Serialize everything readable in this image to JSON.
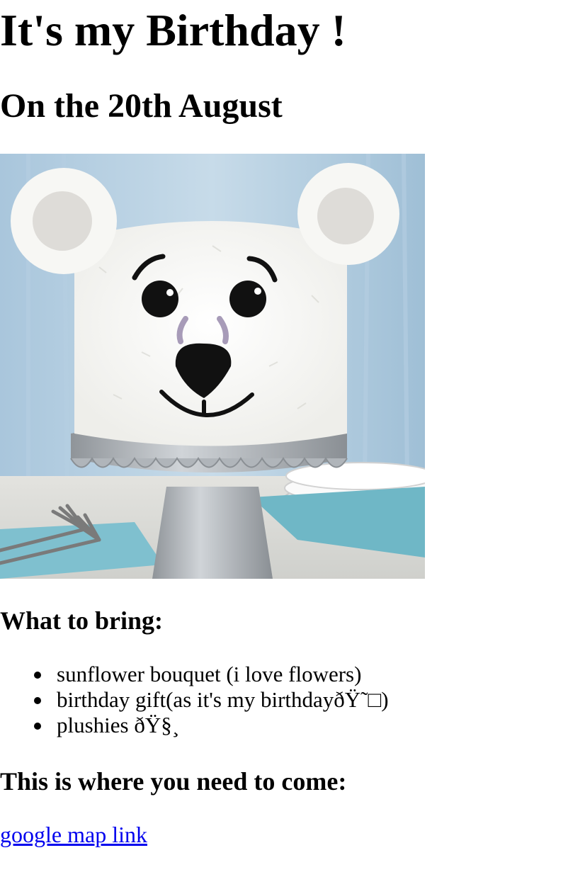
{
  "page": {
    "title": "It's my Birthday !",
    "subtitle": "On the 20th August"
  },
  "image": {
    "alt": "",
    "icon": "polar-bear-cake-photo"
  },
  "bring": {
    "heading": "What to bring:",
    "items": [
      {
        "label": "sunflower bouquet (i love flowers)"
      },
      {
        "label": "birthday gift(as it's my birthdayðŸ˜□)"
      },
      {
        "label": "plushies ðŸ§¸"
      }
    ]
  },
  "location": {
    "heading": "This is where you need to come:",
    "link_label": "google map link"
  },
  "colors": {
    "link": "#0000ee",
    "text": "#000000",
    "background": "#ffffff"
  }
}
